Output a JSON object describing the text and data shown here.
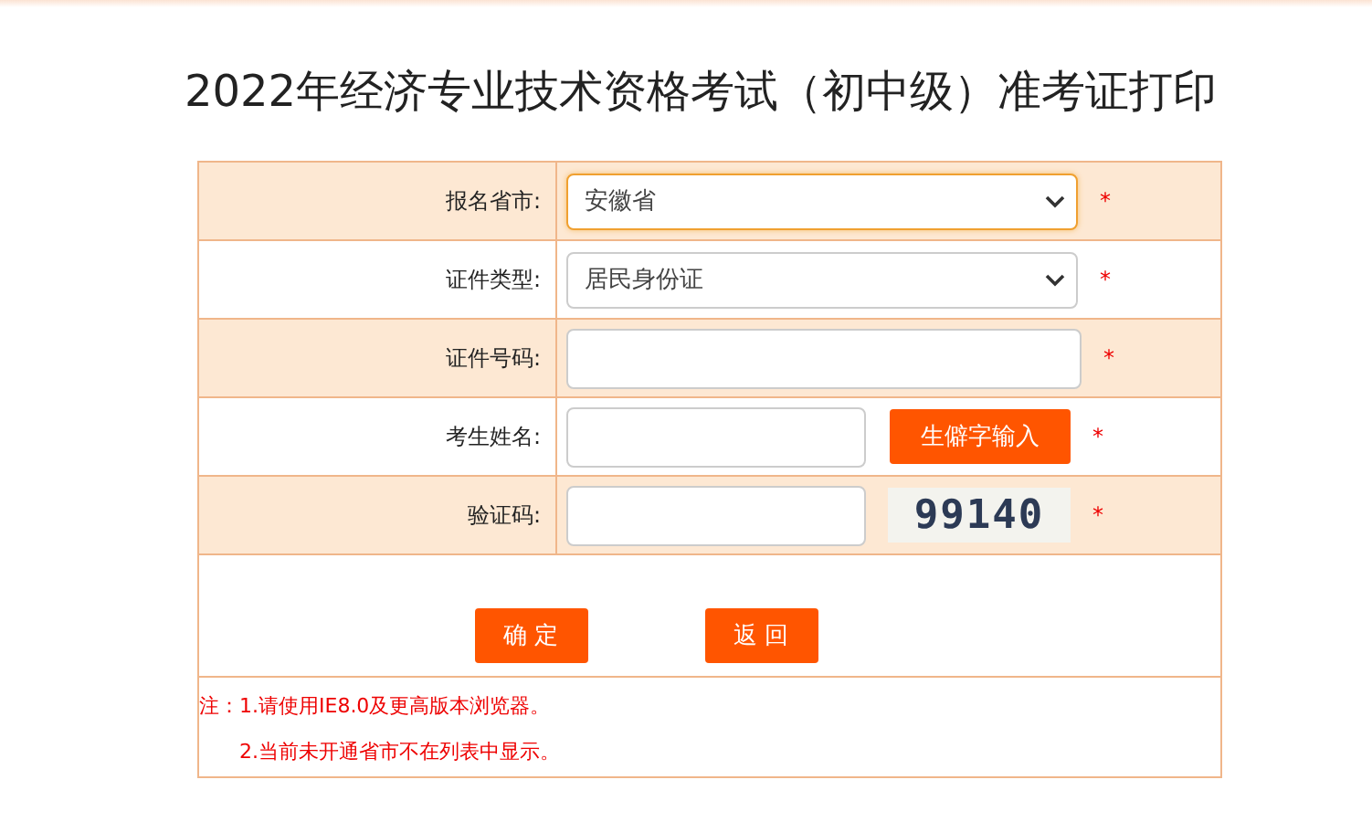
{
  "title": "2022年经济专业技术资格考试（初中级）准考证打印",
  "rows": [
    {
      "label": "报名省市:",
      "kind": "select",
      "value": "安徽省",
      "focused": true,
      "required_mark": "*"
    },
    {
      "label": "证件类型:",
      "kind": "select",
      "value": "居民身份证",
      "focused": false,
      "required_mark": "*"
    },
    {
      "label": "证件号码:",
      "kind": "input",
      "required_mark": "*"
    },
    {
      "label": "考生姓名:",
      "kind": "input_button",
      "button": "生僻字输入",
      "required_mark": "*"
    },
    {
      "label": "验证码:",
      "kind": "captcha",
      "captcha": "99140",
      "required_mark": "*"
    }
  ],
  "buttons": [
    "确 定",
    "返 回"
  ],
  "notes": [
    "注：1.请使用IE8.0及更高版本浏览器。",
    "2.当前未开通省市不在列表中显示。"
  ]
}
